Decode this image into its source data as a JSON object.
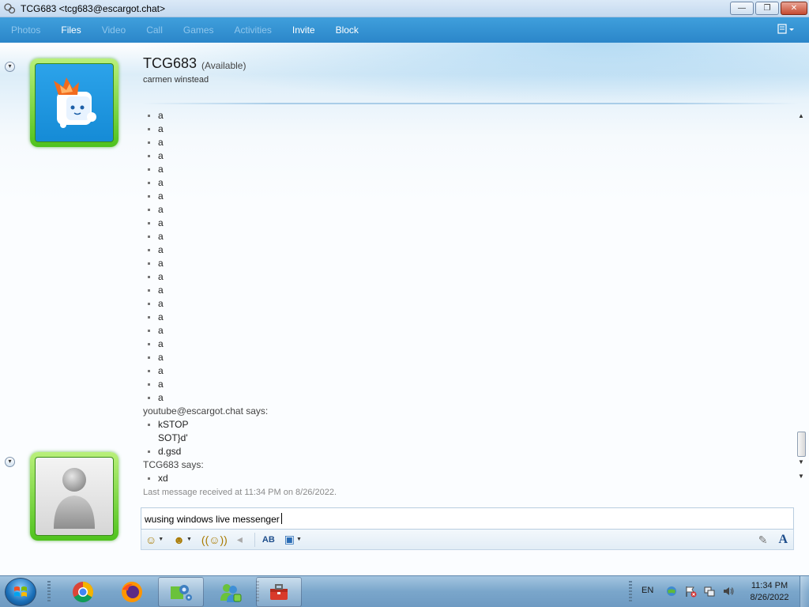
{
  "window": {
    "title": "TCG683 <tcg683@escargot.chat>",
    "minimize_glyph": "—",
    "maximize_glyph": "❐",
    "close_glyph": "✕"
  },
  "toolbar": {
    "items": [
      {
        "label": "Photos",
        "enabled": false
      },
      {
        "label": "Files",
        "enabled": true
      },
      {
        "label": "Video",
        "enabled": false
      },
      {
        "label": "Call",
        "enabled": false
      },
      {
        "label": "Games",
        "enabled": false
      },
      {
        "label": "Activities",
        "enabled": false
      },
      {
        "label": "Invite",
        "enabled": true
      },
      {
        "label": "Block",
        "enabled": true
      }
    ],
    "menu_icon": "window-menu-icon"
  },
  "contact": {
    "name": "TCG683",
    "status": "(Available)",
    "personal_message": "carmen winstead"
  },
  "conversation": {
    "first_block_lines": [
      "a",
      "a",
      "a",
      "a",
      "a",
      "a",
      "a",
      "a",
      "a",
      "a",
      "a",
      "a",
      "a",
      "a",
      "a",
      "a",
      "a",
      "a",
      "a",
      "a",
      "a",
      "a"
    ],
    "second_sender": "youtube@escargot.chat says:",
    "second_lines": [
      {
        "text": "kSTOP",
        "bullet": true
      },
      {
        "text": "SOT}d'",
        "bullet": false
      },
      {
        "text": "d.gsd",
        "bullet": true
      }
    ],
    "third_sender": "TCG683 says:",
    "third_lines": [
      {
        "text": "xd",
        "bullet": true
      }
    ],
    "last_message_info": "Last message received at 11:34 PM on 8/26/2022."
  },
  "input": {
    "value": "wusing windows live messenger"
  },
  "input_toolbar": {
    "emoticon_icon": "emoticon-icon",
    "wink_icon": "wink-icon",
    "nudge_icon": "nudge-icon",
    "voice_clip_icon": "voice-clip-icon",
    "spellcheck_icon": "spellcheck-icon",
    "background_icon": "background-icon",
    "handwriting_icon": "handwriting-icon",
    "font_icon": "font-icon",
    "font_glyph": "A"
  },
  "taskbar": {
    "apps": [
      "start-orb",
      "chrome-icon",
      "firefox-icon",
      "settings-app-icon",
      "messenger-icon",
      "toolbox-icon"
    ],
    "language": "EN",
    "clock_time": "11:34 PM",
    "clock_date": "8/26/2022"
  },
  "colors": {
    "toolbar_bg": "#2b86c9",
    "avatar_frame_green": "#4fc21d",
    "taskbar_bg": "#7aa6cb"
  }
}
